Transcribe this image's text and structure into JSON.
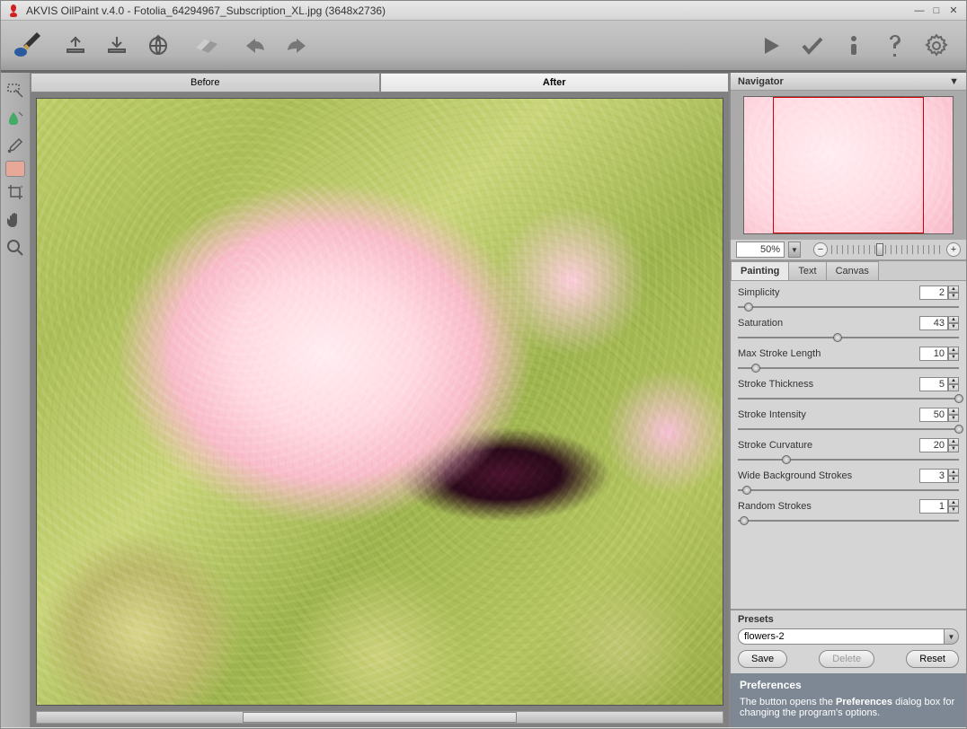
{
  "title": "AKVIS OilPaint v.4.0 - Fotolia_64294967_Subscription_XL.jpg (3648x2736)",
  "tabs": {
    "before": "Before",
    "after": "After"
  },
  "navigator": {
    "title": "Navigator"
  },
  "zoom": {
    "value": "50%"
  },
  "paint_tabs": {
    "painting": "Painting",
    "text": "Text",
    "canvas": "Canvas"
  },
  "params": [
    {
      "label": "Simplicity",
      "value": "2",
      "pos": 3
    },
    {
      "label": "Saturation",
      "value": "43",
      "pos": 43
    },
    {
      "label": "Max Stroke Length",
      "value": "10",
      "pos": 6
    },
    {
      "label": "Stroke Thickness",
      "value": "5",
      "pos": 98
    },
    {
      "label": "Stroke Intensity",
      "value": "50",
      "pos": 98
    },
    {
      "label": "Stroke Curvature",
      "value": "20",
      "pos": 20
    },
    {
      "label": "Wide Background Strokes",
      "value": "3",
      "pos": 2
    },
    {
      "label": "Random Strokes",
      "value": "1",
      "pos": 1
    }
  ],
  "presets": {
    "title": "Presets",
    "selected": "flowers-2",
    "save": "Save",
    "delete": "Delete",
    "reset": "Reset"
  },
  "hint": {
    "title": "Preferences",
    "body_pre": "The button opens the ",
    "body_bold": "Preferences",
    "body_post": " dialog box for changing the program's options."
  }
}
